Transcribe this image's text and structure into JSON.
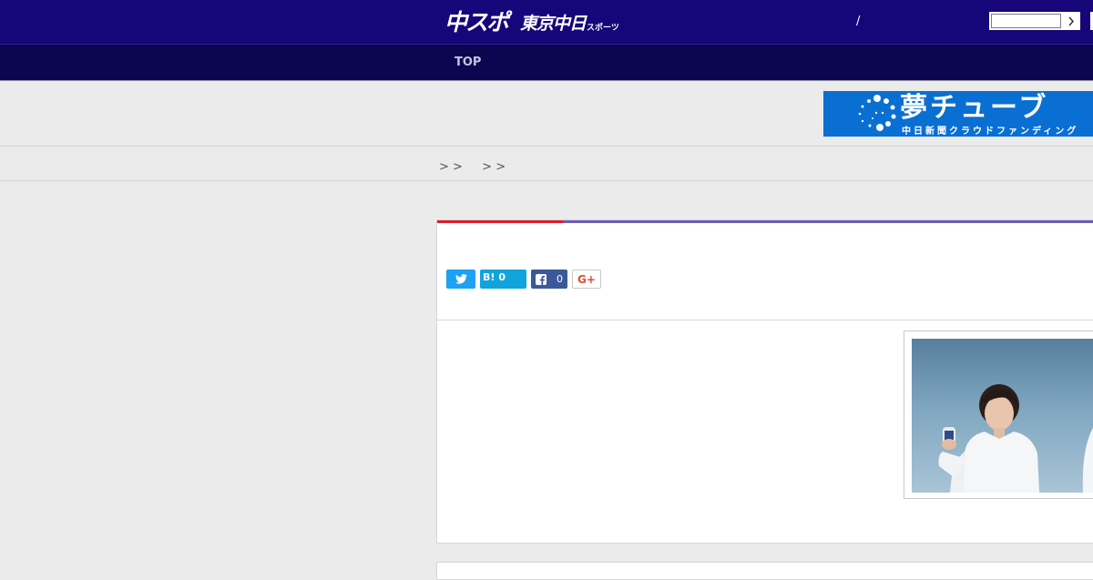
{
  "header": {
    "logo_main": "中スポ",
    "logo_sub": "東京中日",
    "logo_sub2": "スポーツ",
    "separator": "/",
    "search": {
      "placeholder": "",
      "value": "",
      "button_icon": "chevron-right-icon"
    }
  },
  "nav": {
    "top_label": "TOP"
  },
  "banner": {
    "title": "夢チューブ",
    "subtitle": "中日新聞クラウドファンディング",
    "bg_color": "#0a6fd3"
  },
  "breadcrumb": {
    "text": "> >  　 > >"
  },
  "article": {
    "share": {
      "twitter_icon": "twitter-icon",
      "hatena_label": "B!",
      "hatena_count": "0",
      "facebook_icon": "facebook-icon",
      "facebook_count": "0",
      "gplus_label": "G+"
    },
    "accent_colors": {
      "primary": "#e2192c",
      "secondary": "#6e5bb3"
    }
  },
  "colors": {
    "header_bg": "#16067a",
    "nav_bg": "#0c054f"
  }
}
